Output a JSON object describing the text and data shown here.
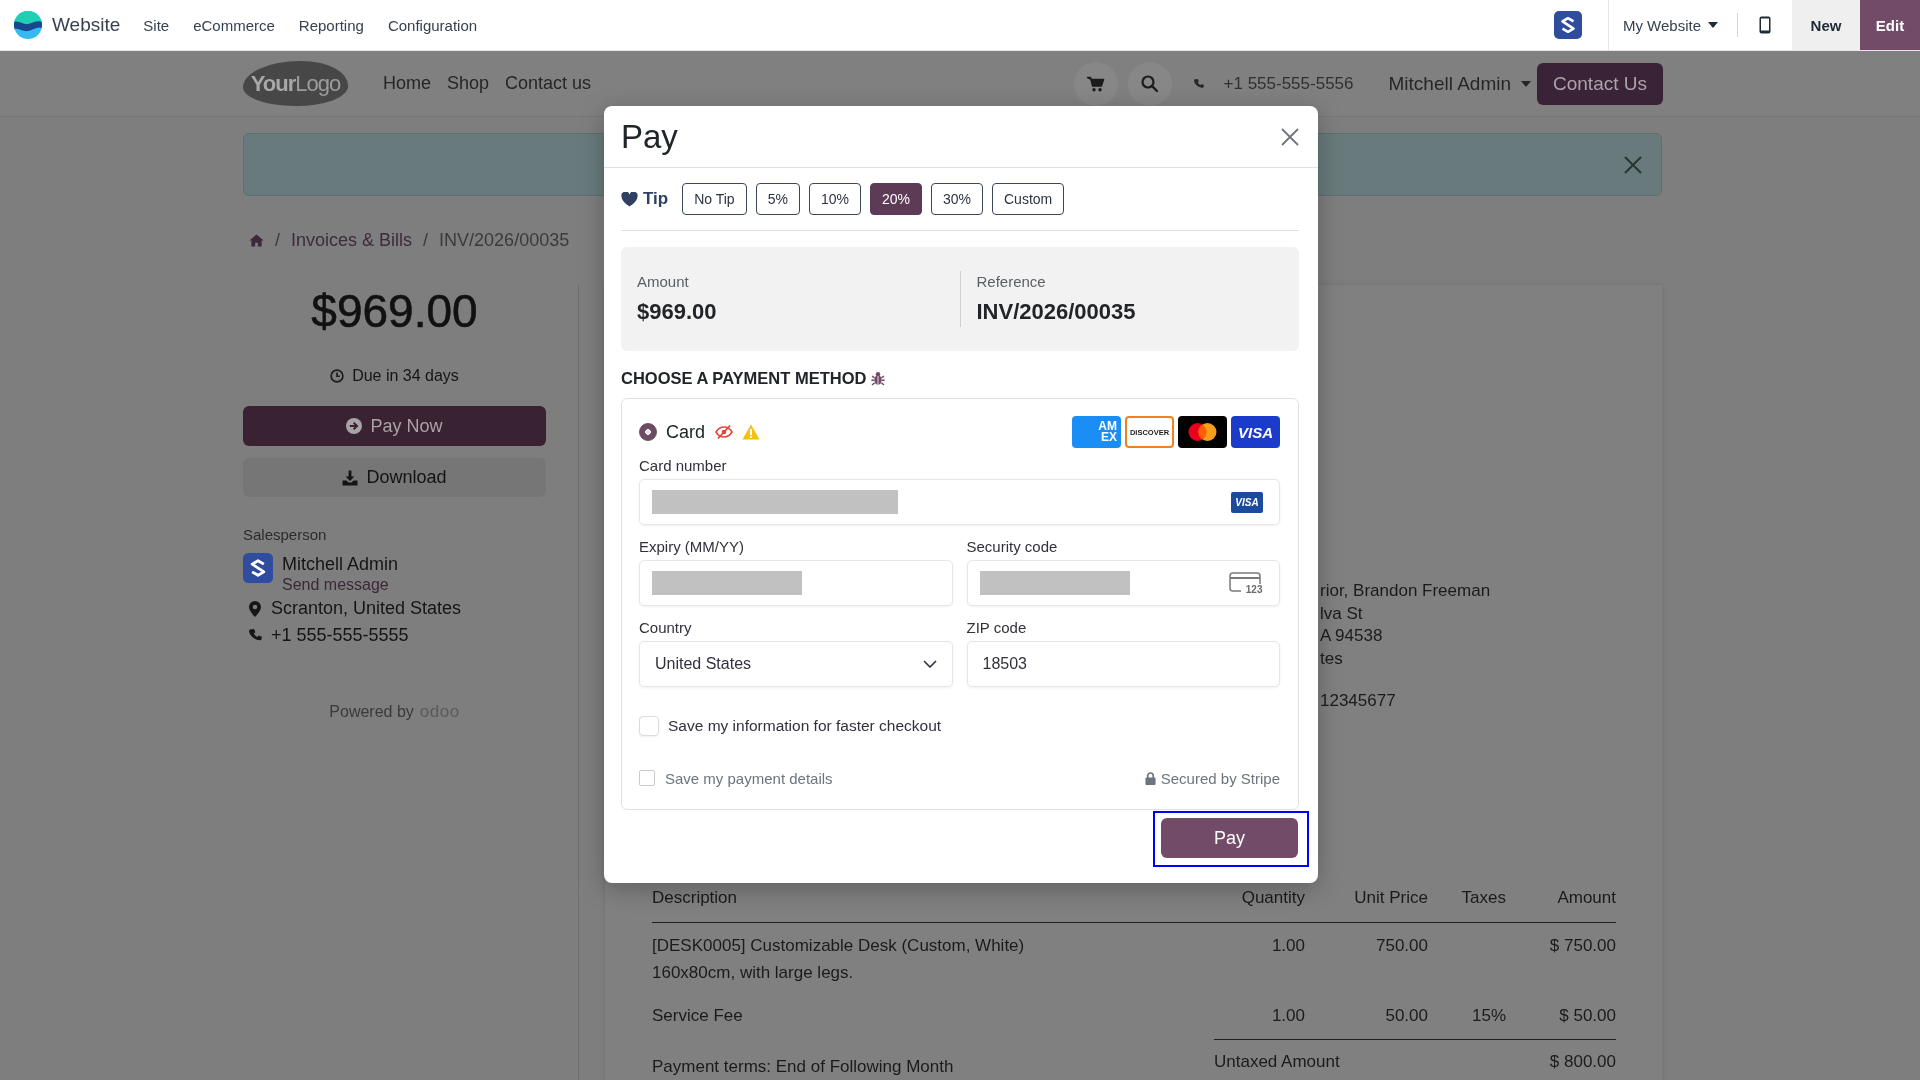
{
  "app_bar": {
    "app_name": "Website",
    "menu": [
      "Site",
      "eCommerce",
      "Reporting",
      "Configuration"
    ],
    "website_switcher": "My Website",
    "actions": [
      {
        "label": "New",
        "kind": "secondary"
      },
      {
        "label": "Edit",
        "kind": "primary"
      }
    ]
  },
  "site_header": {
    "logo": "**Your**Logo",
    "nav": [
      "Home",
      "Shop",
      "Contact us"
    ],
    "phone": "+1 555-555-5556",
    "user": "Mitchell Admin",
    "cta": "Contact Us"
  },
  "breadcrumb": [
    {
      "kind": "home"
    },
    {
      "kind": "separator",
      "text": "/"
    },
    {
      "kind": "link",
      "text": "Invoices & Bills"
    },
    {
      "kind": "separator",
      "text": "/"
    },
    {
      "kind": "current",
      "text": "INV/2026/00035"
    }
  ],
  "sidebar": {
    "total": "$969.00",
    "due": "Due in 34 days",
    "actions": [
      {
        "label": "Pay Now",
        "kind": "primary"
      },
      {
        "label": "Download",
        "kind": "secondary"
      }
    ],
    "salesperson": {
      "label": "Salesperson",
      "name": "Mitchell Admin",
      "action": "Send message"
    },
    "contacts": [
      {
        "kind": "location",
        "text": "Scranton, United States"
      },
      {
        "kind": "phone",
        "text": "+1 555-555-5555"
      }
    ],
    "powered_by": {
      "text": "Powered by",
      "brand": "odoo"
    }
  },
  "invoice": {
    "address_lines": [
      "rior, Brandon Freeman",
      "lva St",
      "A 94538",
      "tes"
    ],
    "id_line": "12345677",
    "table": {
      "columns": [
        "Description",
        "Quantity",
        "Unit Price",
        "Taxes",
        "Amount"
      ],
      "rows": [
        {
          "description": [
            "[DESK0005] Customizable Desk (Custom, White)",
            "160x80cm, with large legs."
          ],
          "quantity": "1.00",
          "unit_price": "750.00",
          "amount": "$ 750.00"
        },
        {
          "description": [
            "Service Fee"
          ],
          "quantity": "1.00",
          "unit_price": "50.00",
          "taxes": "15%",
          "amount": "$ 50.00"
        }
      ]
    },
    "payment_terms": "Payment terms: End of Following Month",
    "totals": [
      {
        "label": "Untaxed Amount",
        "value": "$ 800.00"
      }
    ]
  },
  "pay_dialog": {
    "title": "Pay",
    "tip": {
      "label": "Tip",
      "options": [
        {
          "label": "No Tip",
          "selected": false
        },
        {
          "label": "5%",
          "selected": false
        },
        {
          "label": "10%",
          "selected": false
        },
        {
          "label": "20%",
          "selected": true
        },
        {
          "label": "30%",
          "selected": false
        },
        {
          "label": "Custom",
          "selected": false
        }
      ]
    },
    "amount": {
      "label": "Amount",
      "value": "$969.00"
    },
    "reference": {
      "label": "Reference",
      "value": "INV/2026/00035"
    },
    "method_heading": "CHOOSE A PAYMENT METHOD",
    "methods": [
      {
        "label": "Card",
        "selected": true,
        "brands": [
          {
            "kind": "amex",
            "lines": [
              "AM",
              "EX"
            ]
          },
          {
            "kind": "discover",
            "lines": [
              "DISCOVER"
            ]
          },
          {
            "kind": "mastercard"
          },
          {
            "kind": "visa",
            "lines": [
              "VISA"
            ]
          }
        ],
        "field_rows": [
          [
            {
              "label": "Card number",
              "kind": "masked",
              "badge": "VISA"
            }
          ],
          [
            {
              "label": "Expiry (MM/YY)",
              "kind": "masked"
            },
            {
              "label": "Security code",
              "kind": "masked",
              "hint": "123"
            }
          ],
          [
            {
              "label": "Country",
              "kind": "select",
              "value": "United States"
            },
            {
              "label": "ZIP code",
              "kind": "text",
              "value": "18503"
            }
          ]
        ],
        "checkboxes": [
          {
            "label": "Save my information for faster checkout",
            "checked": false
          }
        ]
      }
    ],
    "save_payment": {
      "label": "Save my payment details",
      "checked": false
    },
    "security_note": "Secured by Stripe",
    "submit": {
      "label": "Pay",
      "focused": true
    }
  }
}
